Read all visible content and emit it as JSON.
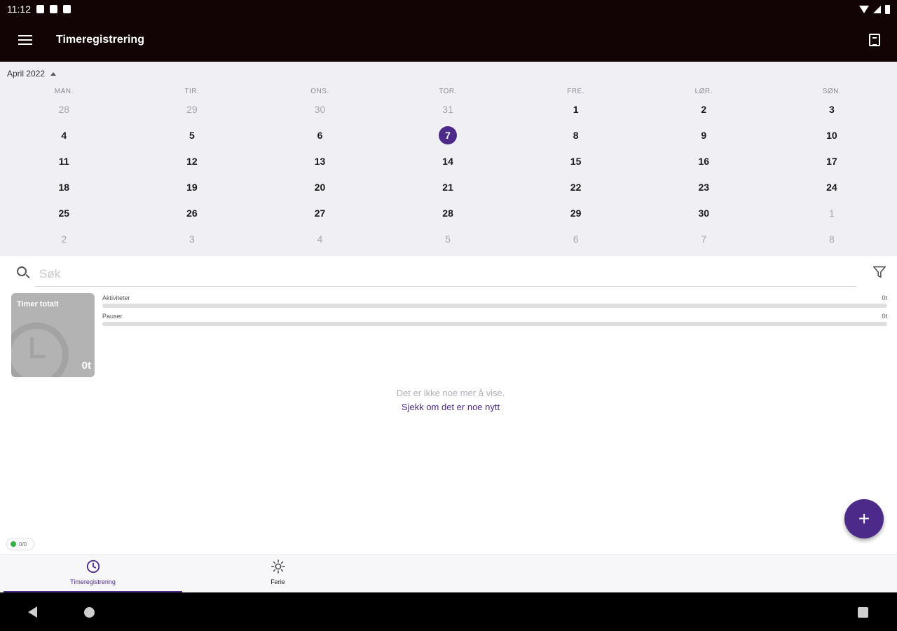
{
  "status_bar": {
    "time": "11:12"
  },
  "app_bar": {
    "title": "Timeregistrering"
  },
  "calendar": {
    "month_label": "April 2022",
    "weekdays": [
      "MAN.",
      "TIR.",
      "ONS.",
      "TOR.",
      "FRE.",
      "LØR.",
      "SØN."
    ],
    "weeks": [
      [
        "28",
        "29",
        "30",
        "31",
        "1",
        "2",
        "3"
      ],
      [
        "4",
        "5",
        "6",
        "7",
        "8",
        "9",
        "10"
      ],
      [
        "11",
        "12",
        "13",
        "14",
        "15",
        "16",
        "17"
      ],
      [
        "18",
        "19",
        "20",
        "21",
        "22",
        "23",
        "24"
      ],
      [
        "25",
        "26",
        "27",
        "28",
        "29",
        "30",
        "1"
      ],
      [
        "2",
        "3",
        "4",
        "5",
        "6",
        "7",
        "8"
      ]
    ],
    "muted_days": [
      [
        0,
        0
      ],
      [
        0,
        1
      ],
      [
        0,
        2
      ],
      [
        0,
        3
      ],
      [
        4,
        6
      ],
      [
        5,
        0
      ],
      [
        5,
        1
      ],
      [
        5,
        2
      ],
      [
        5,
        3
      ],
      [
        5,
        4
      ],
      [
        5,
        5
      ],
      [
        5,
        6
      ]
    ],
    "selected_day": [
      1,
      3
    ]
  },
  "search": {
    "placeholder": "Søk"
  },
  "summary": {
    "card_title": "Timer totalt",
    "total": "0t",
    "rows": [
      {
        "label": "Aktiviteter",
        "value": "0t",
        "fraction": 0
      },
      {
        "label": "Pauser",
        "value": "0t",
        "fraction": 0
      }
    ]
  },
  "empty_state": {
    "message": "Det er ikke noe mer å vise.",
    "refresh_link": "Sjekk om det er noe nytt"
  },
  "fab": {
    "label": "+"
  },
  "sync_badge": {
    "text": "0/0"
  },
  "bottom_nav": {
    "items": [
      {
        "label": "Timeregistrering",
        "icon": "clock-icon",
        "active": true
      },
      {
        "label": "Ferie",
        "icon": "sun-icon",
        "active": false
      }
    ]
  },
  "colors": {
    "accent": "#4b2a8a",
    "app_bar": "#120404",
    "calendar_bg": "#efeff4",
    "sync_ok": "#2fb344"
  }
}
